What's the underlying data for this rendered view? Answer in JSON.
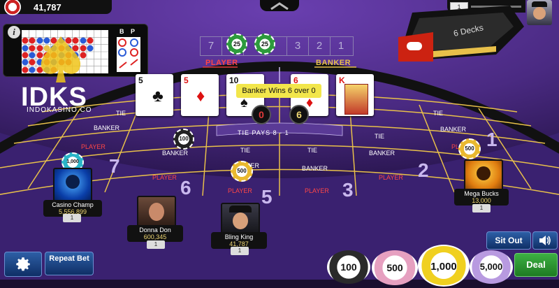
{
  "balance": "41,787",
  "shoe_label": "6 Decks",
  "top_right_counter": "1",
  "logo": {
    "title": "IDKS",
    "subtitle": "INDOKASINO.CO"
  },
  "scoreboard": {
    "info_label": "i",
    "b_label": "B",
    "p_label": "P"
  },
  "roadmap": {
    "cells": [
      "7",
      "25",
      "25",
      "3",
      "2",
      "1"
    ]
  },
  "sides": {
    "player": "PLAYER",
    "banker": "BANKER"
  },
  "cards": {
    "player": [
      {
        "rank": "5",
        "suit": "♣",
        "color": "black"
      },
      {
        "rank": "5",
        "suit": "♦",
        "color": "red"
      },
      {
        "rank": "10",
        "suit": "♠",
        "color": "black"
      }
    ],
    "banker": [
      {
        "rank": "6",
        "suit": "♦",
        "color": "red"
      },
      {
        "rank": "K",
        "suit": "♦",
        "color": "red"
      }
    ]
  },
  "scores": {
    "player": "0",
    "banker": "6"
  },
  "result_text": "Banker Wins 6 over 0",
  "table": {
    "tie_pays": "TIE   PAYS   8 - 1",
    "tie": "TIE",
    "banker": "BANKER",
    "player": "PLAYER",
    "seat_numbers": [
      "7",
      "6",
      "5",
      "3",
      "2",
      "1"
    ]
  },
  "bet_chips": {
    "top": "100",
    "center": "500",
    "seat1": "500",
    "seat7": "1,000"
  },
  "players": [
    {
      "name": "Casino Champ",
      "cash": "5,556,899",
      "tag": "1"
    },
    {
      "name": "Donna Don",
      "cash": "600,345",
      "tag": "1"
    },
    {
      "name": "Bling King",
      "cash": "41,787",
      "tag": "1"
    },
    {
      "name": "Mega Bucks",
      "cash": "13,000",
      "tag": "1"
    }
  ],
  "buttons": {
    "repeat_bet": "Repeat Bet",
    "sit_out": "Sit Out",
    "deal": "Deal"
  },
  "chip_tray": [
    "100",
    "500",
    "1,000",
    "5,000"
  ],
  "colors": {
    "felt": "#4a2a82",
    "gold_line": "#e8c04a",
    "deal": "#2e9a35",
    "blue_button": "#1d4588"
  }
}
